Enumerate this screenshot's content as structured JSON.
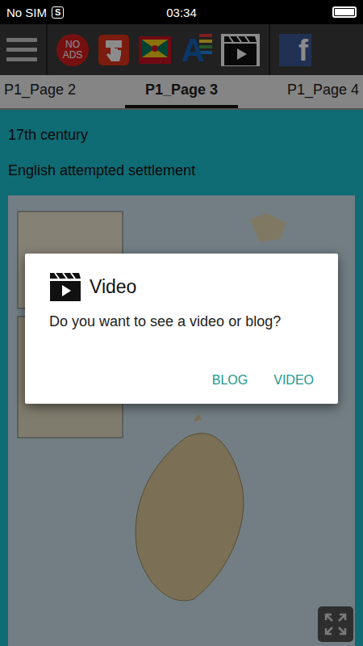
{
  "status_bar": {
    "carrier": "No SIM",
    "sim_icon": "S",
    "time": "03:34"
  },
  "toolbar": {
    "no_ads": "NO ADS",
    "font_icon": "A",
    "facebook_icon": "f"
  },
  "tabs": [
    {
      "label": "P1_Page 2",
      "selected": false
    },
    {
      "label": "P1_Page 3",
      "selected": true
    },
    {
      "label": "P1_Page 4",
      "selected": false
    }
  ],
  "content": {
    "heading": "17th century",
    "subheading": "English attempted settlement"
  },
  "dialog": {
    "title": "Video",
    "message": "Do you want to see a video or blog?",
    "buttons": [
      "BLOG",
      "VIDEO"
    ]
  }
}
